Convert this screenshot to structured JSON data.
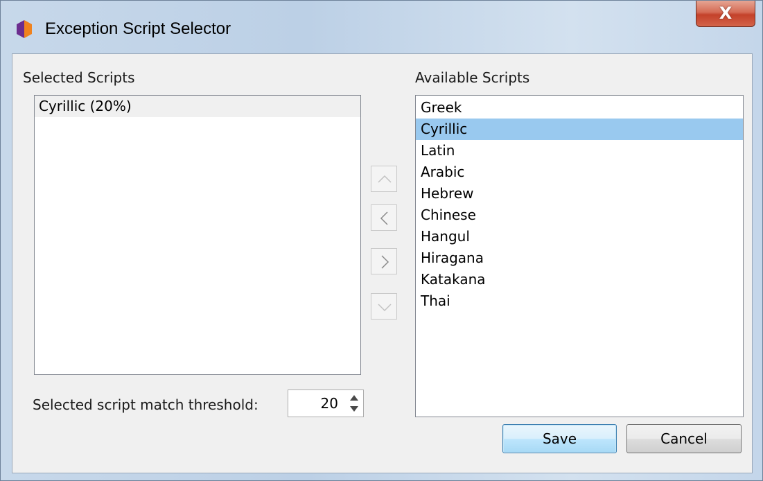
{
  "window": {
    "title": "Exception Script Selector",
    "close_label": "X"
  },
  "left_panel": {
    "label": "Selected Scripts",
    "items": [
      "Cyrillic (20%)"
    ]
  },
  "right_panel": {
    "label": "Available Scripts",
    "items": [
      "Greek",
      "Cyrillic",
      "Latin",
      "Arabic",
      "Hebrew",
      "Chinese",
      "Hangul",
      "Hiragana",
      "Katakana",
      "Thai"
    ],
    "selected": "Cyrillic"
  },
  "arrows": {
    "up_icon": "chevron-up-icon",
    "left_icon": "chevron-left-icon",
    "right_icon": "chevron-right-icon",
    "down_icon": "chevron-down-icon"
  },
  "threshold": {
    "label": "Selected script match threshold:",
    "value": "20"
  },
  "buttons": {
    "save": "Save",
    "cancel": "Cancel"
  },
  "colors": {
    "selection": "#99c9ef",
    "close_button": "#c4412a",
    "save_border": "#3c7fb1"
  }
}
